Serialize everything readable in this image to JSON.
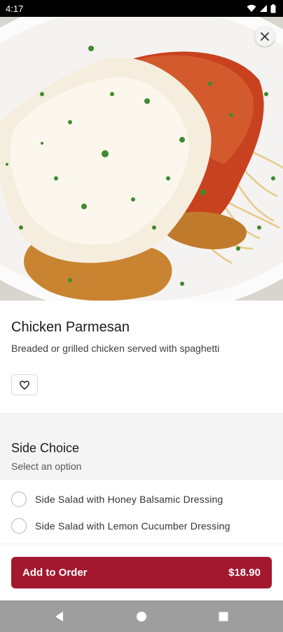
{
  "status_bar": {
    "time": "4:17"
  },
  "item": {
    "name": "Chicken Parmesan",
    "description": "Breaded or grilled chicken served with spaghetti"
  },
  "options_section": {
    "title": "Side Choice",
    "subtitle": "Select an option",
    "options": [
      {
        "label": "Side Salad with Honey Balsamic Dressing"
      },
      {
        "label": "Side Salad with Lemon Cucumber Dressing"
      }
    ]
  },
  "footer": {
    "add_label": "Add to Order",
    "price": "$18.90"
  },
  "colors": {
    "accent": "#a3172f",
    "section_bg": "#f4f4f5",
    "nav_bar": "#9e9e9e"
  },
  "icons": [
    "wifi-icon",
    "signal-icon",
    "battery-icon",
    "close-icon",
    "heart-icon",
    "back-icon",
    "home-icon",
    "recents-icon"
  ]
}
